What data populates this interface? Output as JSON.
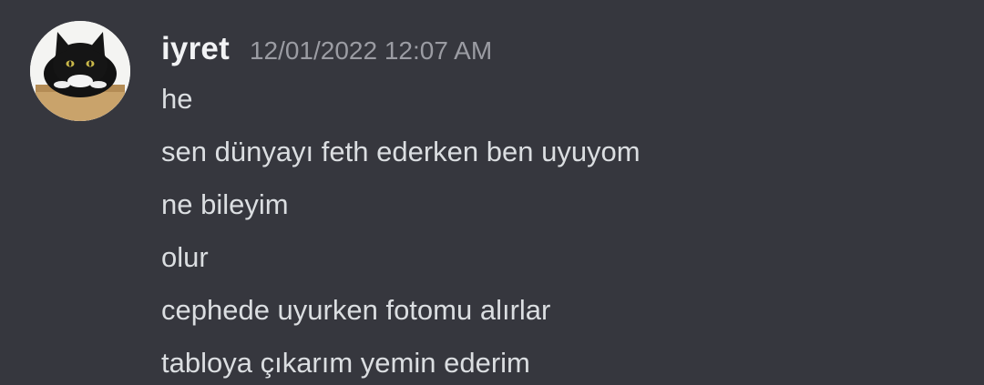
{
  "message": {
    "author": "iyret",
    "timestamp": "12/01/2022 12:07 AM",
    "avatar_icon": "cat-in-box-avatar",
    "lines": [
      "he",
      "sen dünyayı feth ederken ben uyuyom",
      "ne bileyim",
      "olur",
      "cephede uyurken fotomu alırlar",
      "tabloya çıkarım yemin ederim"
    ]
  },
  "colors": {
    "background": "#36373e",
    "username": "#f2f3f5",
    "timestamp": "#9b9ca3",
    "message_text": "#dbdee1"
  }
}
